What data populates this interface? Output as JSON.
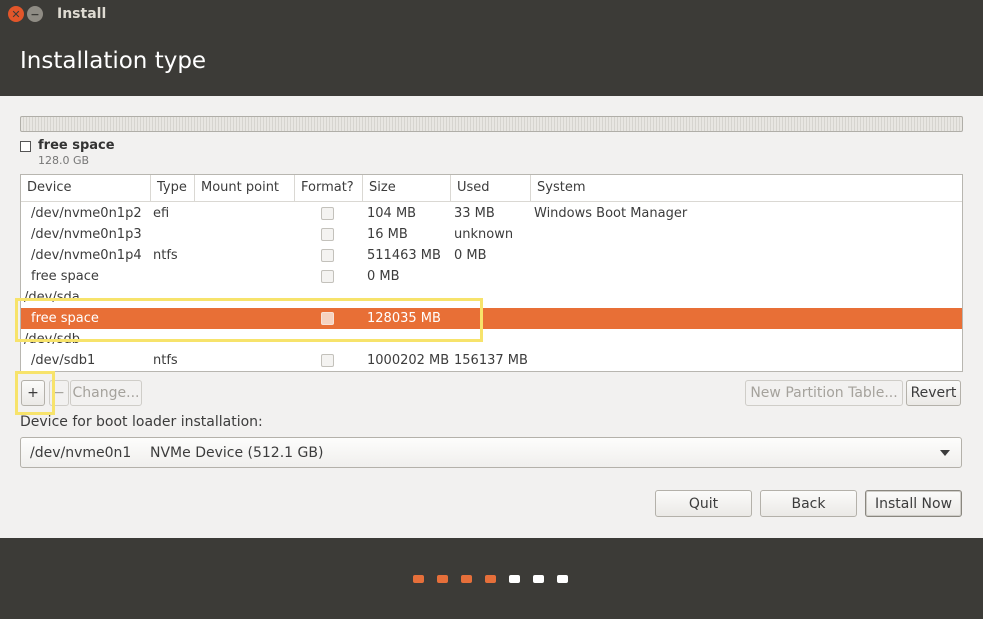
{
  "window": {
    "title": "Install"
  },
  "header": {
    "title": "Installation type"
  },
  "legend": {
    "name": "free space",
    "size": "128.0 GB"
  },
  "table": {
    "columns": [
      "Device",
      "Type",
      "Mount point",
      "Format?",
      "Size",
      "Used",
      "System"
    ],
    "rows": [
      {
        "device": "/dev/nvme0n1p2",
        "type": "efi",
        "mount": "",
        "format": true,
        "size": "104 MB",
        "used": "33 MB",
        "system": "Windows Boot Manager"
      },
      {
        "device": "/dev/nvme0n1p3",
        "type": "",
        "mount": "",
        "format": true,
        "size": "16 MB",
        "used": "unknown",
        "system": ""
      },
      {
        "device": "/dev/nvme0n1p4",
        "type": "ntfs",
        "mount": "",
        "format": true,
        "size": "511463 MB",
        "used": "0 MB",
        "system": ""
      },
      {
        "device": "free space",
        "type": "",
        "mount": "",
        "format": true,
        "size": "0 MB",
        "used": "",
        "system": ""
      },
      {
        "device": "/dev/sda",
        "group": true
      },
      {
        "device": "free space",
        "type": "",
        "mount": "",
        "format": true,
        "size": "128035 MB",
        "used": "",
        "system": "",
        "selected": true
      },
      {
        "device": "/dev/sdb",
        "group": true
      },
      {
        "device": "/dev/sdb1",
        "type": "ntfs",
        "mount": "",
        "format": true,
        "size": "1000202 MB",
        "used": "156137 MB",
        "system": ""
      }
    ]
  },
  "toolbar": {
    "add_label": "+",
    "remove_label": "−",
    "change_label": "Change...",
    "new_table_label": "New Partition Table...",
    "revert_label": "Revert"
  },
  "bootloader": {
    "label": "Device for boot loader installation:",
    "device": "/dev/nvme0n1",
    "description": "NVMe Device (512.1 GB)"
  },
  "actions": {
    "quit_label": "Quit",
    "back_label": "Back",
    "install_label": "Install Now"
  },
  "progress": {
    "total_steps": 7,
    "completed_steps": 4
  },
  "colors": {
    "accent": "#e86f36",
    "header_bg": "#3c3b37",
    "step_done": "#e66f3a",
    "step_todo": "#ffffff",
    "highlight": "#f7e36b"
  }
}
